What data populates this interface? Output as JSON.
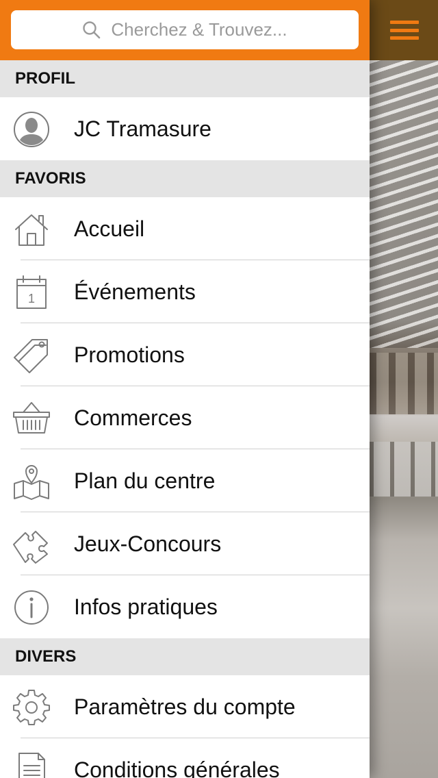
{
  "search": {
    "placeholder": "Cherchez & Trouvez..."
  },
  "menu_button": {
    "icon": "hamburger-menu-icon"
  },
  "colors": {
    "accent": "#f07a12",
    "header_bg": "#e4e4e4",
    "topbar_dark": "#6b4a17"
  },
  "sections": {
    "profil": {
      "title": "PROFIL",
      "items": [
        {
          "label": "JC Tramasure",
          "icon": "user-avatar-icon"
        }
      ]
    },
    "favoris": {
      "title": "FAVORIS",
      "items": [
        {
          "label": "Accueil",
          "icon": "home-icon"
        },
        {
          "label": "Événements",
          "icon": "calendar-icon"
        },
        {
          "label": "Promotions",
          "icon": "tag-icon"
        },
        {
          "label": "Commerces",
          "icon": "basket-icon"
        },
        {
          "label": "Plan du centre",
          "icon": "map-icon"
        },
        {
          "label": "Jeux-Concours",
          "icon": "puzzle-icon"
        },
        {
          "label": "Infos pratiques",
          "icon": "info-icon"
        }
      ]
    },
    "divers": {
      "title": "DIVERS",
      "items": [
        {
          "label": "Paramètres du compte",
          "icon": "gear-icon"
        },
        {
          "label": "Conditions générales",
          "icon": "document-icon"
        }
      ]
    }
  },
  "calendar_day": "1"
}
